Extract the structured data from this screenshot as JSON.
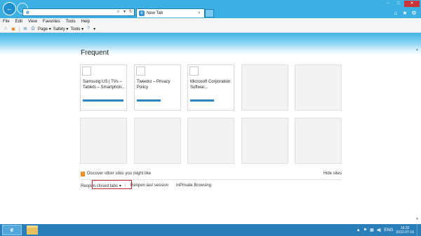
{
  "browser": {
    "address_value": "",
    "tab_label": "New Tab",
    "tab_close": "×",
    "window_controls": [
      "–",
      "□",
      "✕"
    ],
    "right_icons": [
      "⌂",
      "★",
      "⚙"
    ]
  },
  "menubar": {
    "items": [
      "File",
      "Edit",
      "View",
      "Favorites",
      "Tools",
      "Help"
    ]
  },
  "commandbar": {
    "page_label": "Page ▾",
    "safety_label": "Safety ▾",
    "tools_label": "Tools ▾",
    "help_label": "▾"
  },
  "newtab": {
    "heading": "Frequent",
    "tiles": [
      {
        "label": "Samsung US | TVs – Tablets – Smartphon...",
        "empty": false
      },
      {
        "label": "Tweetro – Privacy Policy",
        "empty": false
      },
      {
        "label": "Microsoft Corporation: Softwar...",
        "empty": false
      },
      {
        "label": "",
        "empty": true
      },
      {
        "label": "",
        "empty": true
      },
      {
        "label": "",
        "empty": true
      },
      {
        "label": "",
        "empty": true
      },
      {
        "label": "",
        "empty": true
      },
      {
        "label": "",
        "empty": true
      },
      {
        "label": "",
        "empty": true
      }
    ],
    "discover_text": "Discover other sites you might like",
    "hide_sites": "Hide sites",
    "reopen_closed_tabs": "Reopen closed tabs ▾",
    "reopen_last_session": "Reopen last session",
    "inprivate": "InPrivate Browsing",
    "separator": "|"
  },
  "taskbar": {
    "ie_glyph": "e",
    "language": "ENG",
    "time": "16:32",
    "date": "2012-07-16"
  },
  "colors": {
    "chrome_blue": "#3cb0e3",
    "taskbar_blue": "#2a7fb8",
    "tile_bar": "#2b86c8",
    "inprivate_highlight": "#c8282f"
  }
}
